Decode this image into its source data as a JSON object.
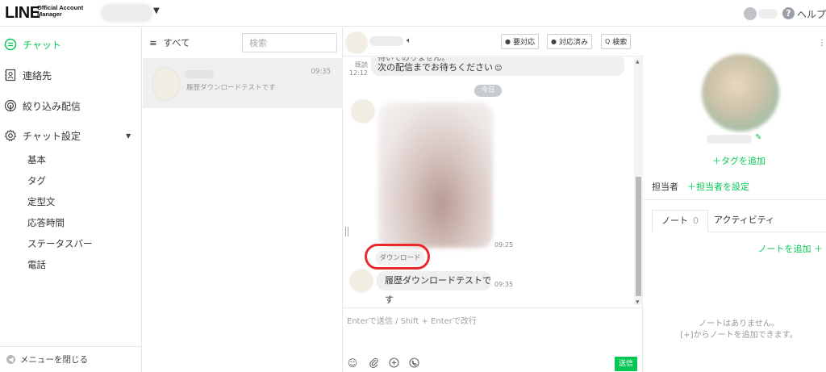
{
  "header": {
    "logo_main": "LINE",
    "logo_sub_line1": "Official Account",
    "logo_sub_line2": "Manager",
    "help": "ヘルプ"
  },
  "sidebar": {
    "items": [
      {
        "label": "チャット",
        "icon": "chat-bubble-icon"
      },
      {
        "label": "連絡先",
        "icon": "contacts-icon"
      },
      {
        "label": "絞り込み配信",
        "icon": "broadcast-icon"
      },
      {
        "label": "チャット設定",
        "icon": "gear-icon"
      }
    ],
    "settings_sub": [
      "基本",
      "タグ",
      "定型文",
      "応答時間",
      "ステータスバー",
      "電話"
    ],
    "collapse": "メニューを閉じる"
  },
  "chatlist": {
    "filter_label": "すべて",
    "search_placeholder": "検索",
    "rows": [
      {
        "time": "09:35",
        "preview": "履歴ダウンロードテストです"
      }
    ]
  },
  "chat": {
    "header_buttons": [
      "要対応",
      "対応済み",
      "検索"
    ],
    "messages": {
      "partial_top": "待いてのりません。",
      "prev_line": "次の配信までお待ちください",
      "read_label": "既読",
      "read_time": "12:12",
      "date_pill": "今日",
      "image_time": "09:25",
      "download": "ダウンロード",
      "text_msg": "履歴ダウンロードテストです",
      "text_time": "09:35"
    },
    "composer_placeholder": "Enterで送信 / Shift + Enterで改行",
    "send": "送信"
  },
  "profile": {
    "add_tag": "＋タグを追加",
    "owner_label": "担当者",
    "owner_add": "＋担当者を設定",
    "tabs": [
      {
        "label": "ノート",
        "count": "0"
      },
      {
        "label": "アクティビティ"
      }
    ],
    "add_note": "ノートを追加 ＋",
    "empty_line1": "ノートはありません。",
    "empty_line2": "[+]からノートを追加できます。"
  },
  "colors": {
    "accent": "#06c755",
    "highlight_ring": "#ea2a2a"
  }
}
